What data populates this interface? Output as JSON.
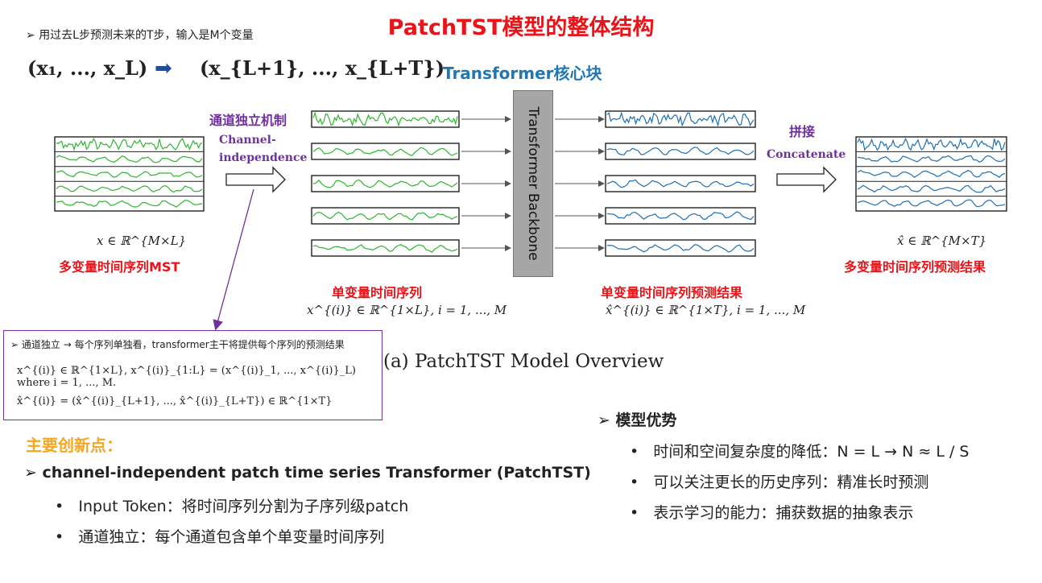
{
  "title": "PatchTST模型的整体结构",
  "intro": {
    "bullet": "用过去L步预测未来的T步，输入是M个变量",
    "input_seq": "(x₁, ..., x_L)",
    "output_seq": "(x_{L+1}, ..., x_{L+T})"
  },
  "transformer_header": "Transformer核心块",
  "channel_indep": {
    "cn": "通道独立机制",
    "en1": "Channel-",
    "en2": "independence"
  },
  "concat": {
    "cn": "拼接",
    "en": "Concatenate"
  },
  "backbone_label": "Transformer Backbone",
  "mst": {
    "formula": "x ∈ ℝ^{M×L}",
    "label": "多变量时间序列MST"
  },
  "uni": {
    "label": "单变量时间序列",
    "formula": "x^{(i)} ∈ ℝ^{1×L}, i = 1, ..., M"
  },
  "uni_pred": {
    "label": "单变量时间序列预测结果",
    "formula": "x̂^{(i)} ∈ ℝ^{1×T}, i = 1, ..., M"
  },
  "mst_pred": {
    "formula": "x̂ ∈ ℝ^{M×T}",
    "label": "多变量时间序列预测结果"
  },
  "callout": {
    "line1": "通道独立 → 每个序列单独看，transformer主干将提供每个序列的预测结果",
    "line2": "x^{(i)} ∈ ℝ^{1×L},   x^{(i)}_{1:L} = (x^{(i)}_1, ..., x^{(i)}_L) where i = 1, ..., M.",
    "line3": "x̂^{(i)} = (x̂^{(i)}_{L+1}, ..., x̂^{(i)}_{L+T}) ∈ ℝ^{1×T}"
  },
  "overview_caption": "(a) PatchTST Model Overview",
  "innovations": {
    "title": "主要创新点：",
    "main": "channel-independent patch time series Transformer (PatchTST)",
    "items": [
      "Input Token：将时间序列分割为子序列级patch",
      "通道独立：每个通道包含单个单变量时间序列"
    ]
  },
  "advantages": {
    "title": "模型优势",
    "items": [
      "时间和空间复杂度的降低：N = L → N ≈ L / S",
      "可以关注更长的历史序列：精准长时预测",
      "表示学习的能力：捕获数据的抽象表示"
    ]
  },
  "colors": {
    "green": "#2fb52f",
    "blue": "#1f6fb4",
    "red": "#e8141a",
    "purple": "#7030a0",
    "orange": "#f5a623"
  },
  "icons": [
    "right-arrow-icon",
    "block-arrow-icon"
  ]
}
